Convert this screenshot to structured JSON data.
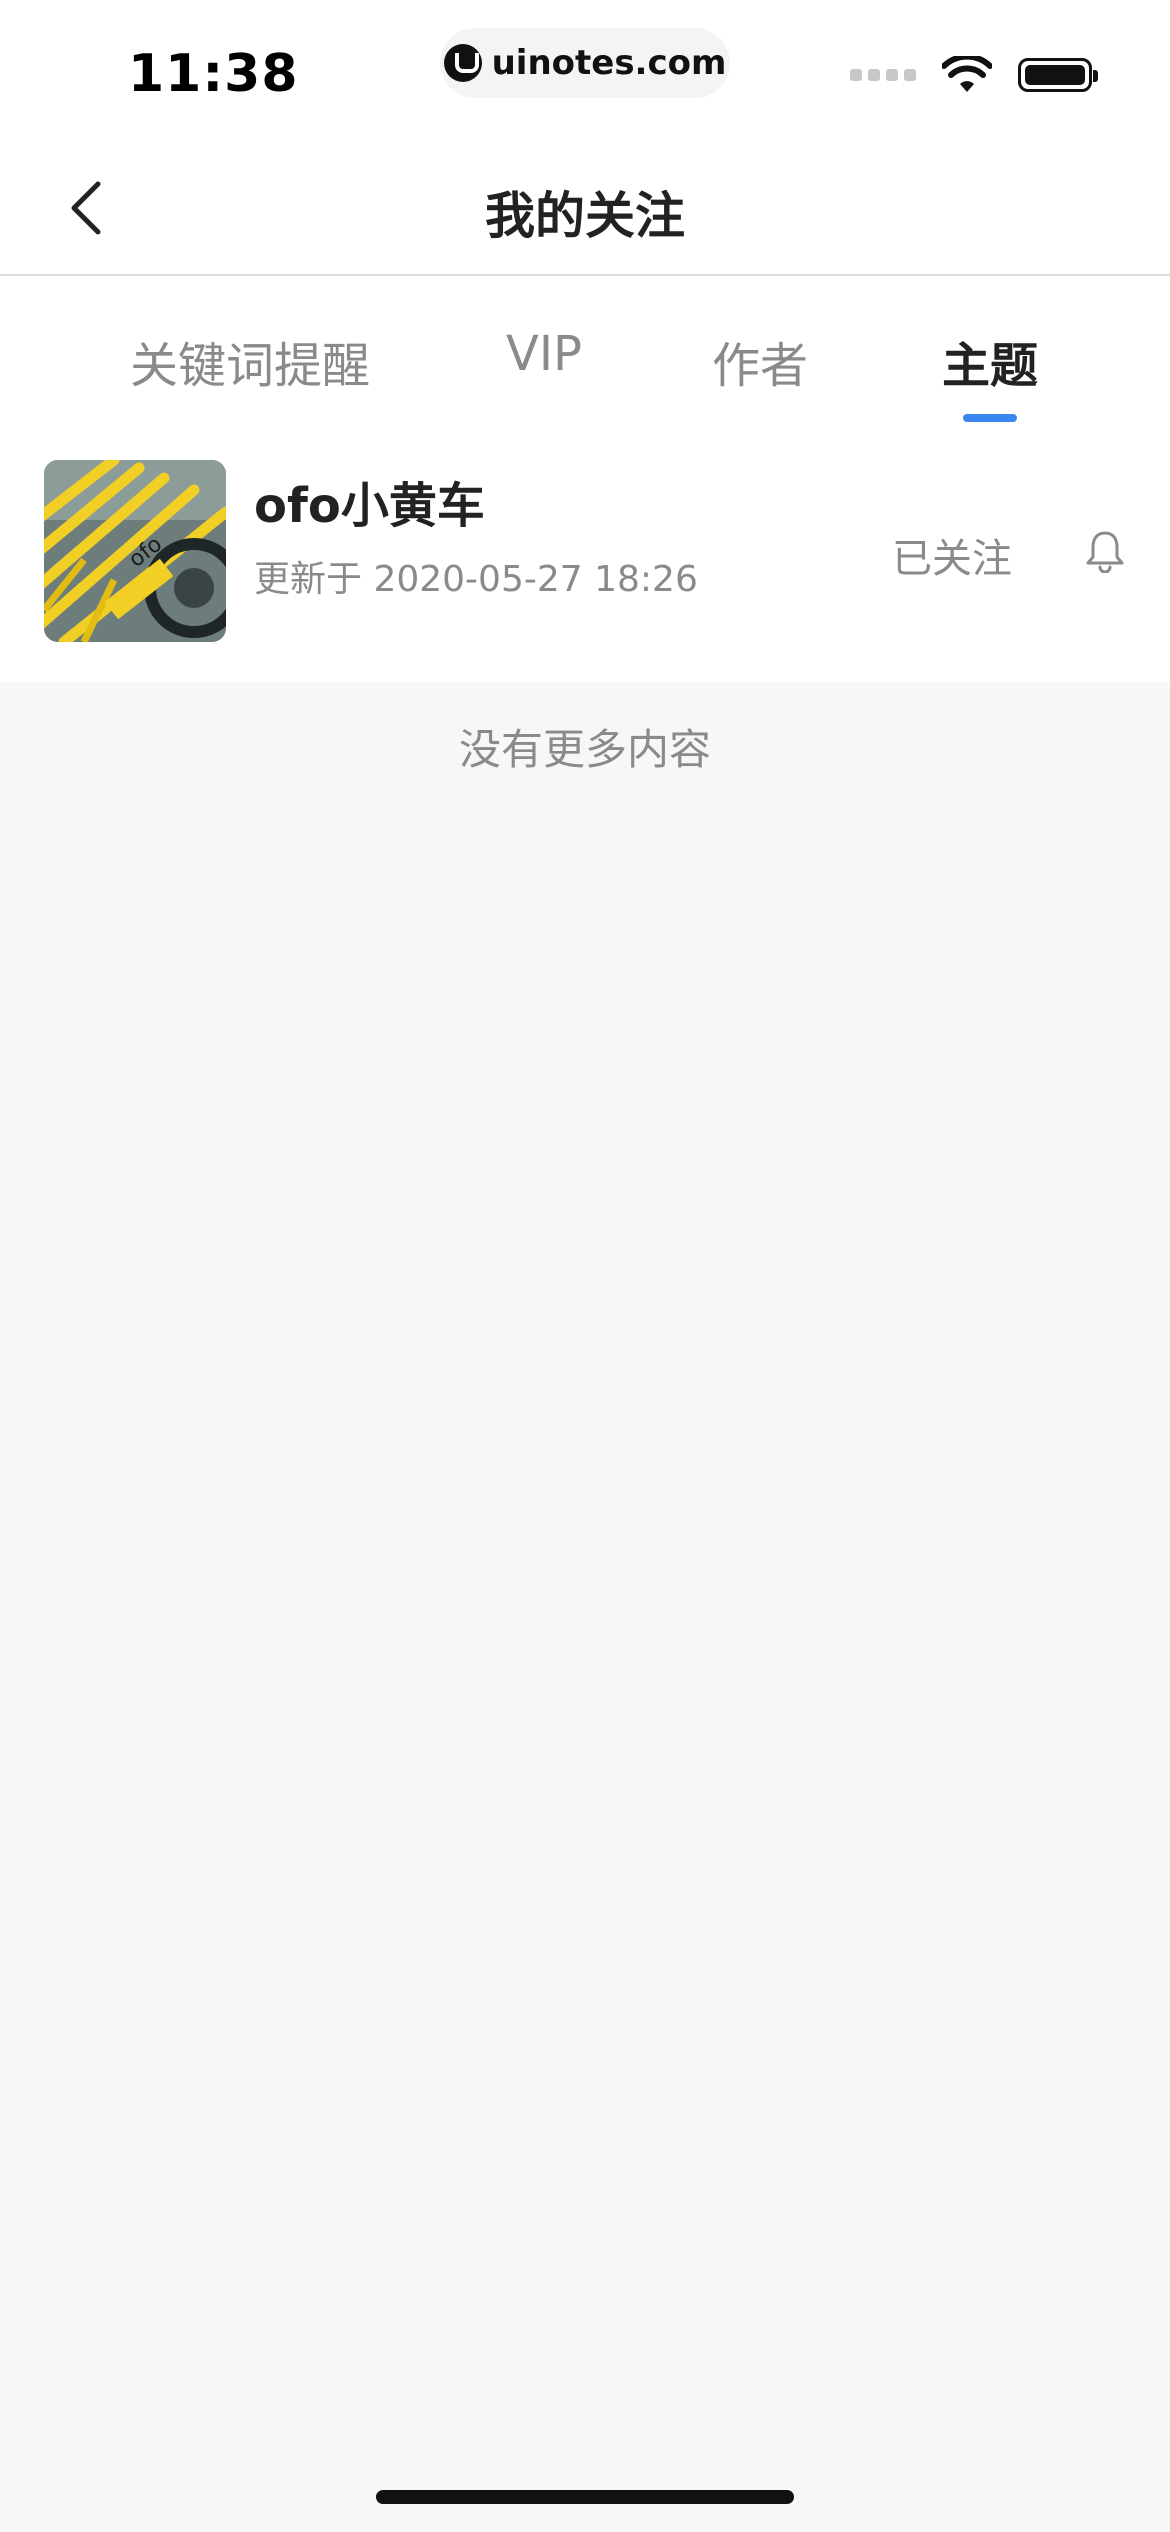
{
  "status_bar": {
    "time": "11:38",
    "url": "uinotes.com"
  },
  "nav": {
    "title": "我的关注"
  },
  "tabs": [
    {
      "label": "关键词提醒",
      "active": false
    },
    {
      "label": "VIP",
      "active": false
    },
    {
      "label": "作者",
      "active": false
    },
    {
      "label": "主题",
      "active": true
    }
  ],
  "list": {
    "items": [
      {
        "title": "ofo小黄车",
        "subtitle": "更新于 2020-05-27 18:26",
        "follow_label": "已关注",
        "thumb_text": "ofo"
      }
    ],
    "end_text": "没有更多内容"
  },
  "colors": {
    "accent": "#3a86f0",
    "muted_text": "#8a8a8a",
    "primary_text": "#222222",
    "background": "#f7f7f7"
  },
  "icons": {
    "back": "chevron-left-icon",
    "bell": "bell-icon",
    "wifi": "wifi-icon",
    "battery": "battery-icon"
  }
}
